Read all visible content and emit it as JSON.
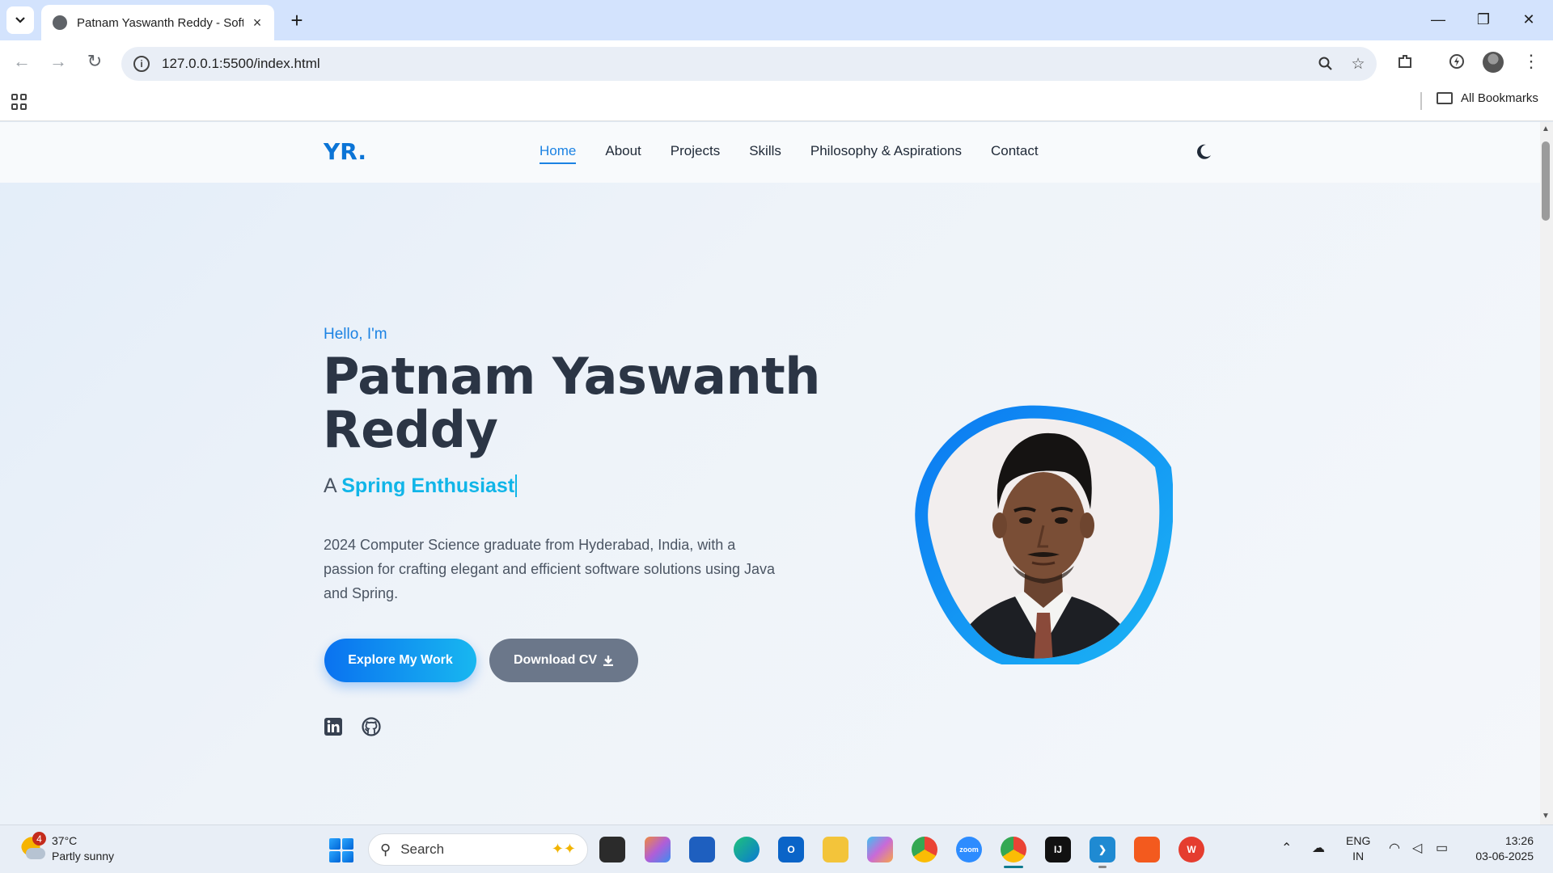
{
  "browser": {
    "tab_title": "Patnam Yaswanth Reddy - Software Developer",
    "url": "127.0.0.1:5500/index.html",
    "bookmarks_label": "All Bookmarks",
    "window_controls": {
      "minimize": "—",
      "restore": "❐",
      "close": "✕"
    }
  },
  "site": {
    "logo": "YR.",
    "nav": [
      "Home",
      "About",
      "Projects",
      "Skills",
      "Philosophy & Aspirations",
      "Contact"
    ],
    "active_nav": "Home",
    "hero": {
      "greeting": "Hello, I'm",
      "name": "Patnam Yaswanth Reddy",
      "role_prefix": "A",
      "role_highlight": "Spring Enthusiast",
      "intro": "2024 Computer Science graduate from Hyderabad, India, with a passion for crafting elegant and efficient software solutions using Java and Spring.",
      "primary_button": "Explore My Work",
      "secondary_button": "Download CV",
      "social": [
        "linkedin-icon",
        "github-icon"
      ]
    },
    "colors": {
      "accent": "#1b82e3",
      "highlight": "#10b5e8",
      "heading": "#2b3545"
    }
  },
  "taskbar": {
    "weather_temp": "37°C",
    "weather_desc": "Partly sunny",
    "weather_badge": "4",
    "search_placeholder": "Search",
    "lang_line1": "ENG",
    "lang_line2": "IN",
    "time": "13:26",
    "date": "03-06-2025"
  }
}
